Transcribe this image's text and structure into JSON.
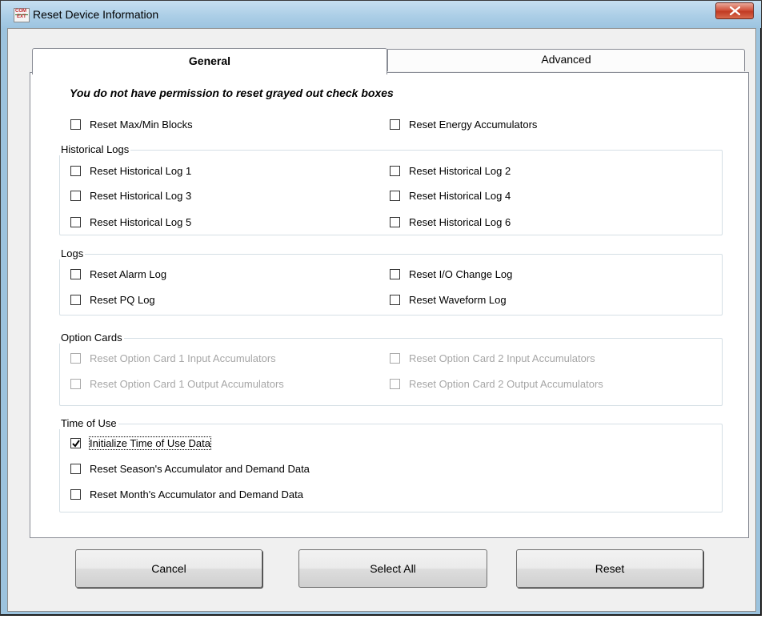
{
  "window": {
    "title": "Reset Device Information",
    "icon_top": "COM",
    "icon_bottom": "EXT"
  },
  "tabs": [
    {
      "label": "General",
      "selected": true
    },
    {
      "label": "Advanced",
      "selected": false
    }
  ],
  "notice": "You do not have permission to reset grayed out check boxes",
  "top_checks": [
    {
      "label": "Reset Max/Min Blocks",
      "checked": false,
      "enabled": true
    },
    {
      "label": "Reset Energy Accumulators",
      "checked": false,
      "enabled": true
    }
  ],
  "groups": {
    "historical_logs": {
      "title": "Historical Logs",
      "items": [
        {
          "label": "Reset Historical Log 1",
          "checked": false,
          "enabled": true
        },
        {
          "label": "Reset Historical Log 2",
          "checked": false,
          "enabled": true
        },
        {
          "label": "Reset Historical Log 3",
          "checked": false,
          "enabled": true
        },
        {
          "label": "Reset Historical Log 4",
          "checked": false,
          "enabled": true
        },
        {
          "label": "Reset Historical Log 5",
          "checked": false,
          "enabled": true
        },
        {
          "label": "Reset Historical Log 6",
          "checked": false,
          "enabled": true
        }
      ]
    },
    "logs": {
      "title": "Logs",
      "items": [
        {
          "label": "Reset Alarm Log",
          "checked": false,
          "enabled": true
        },
        {
          "label": "Reset I/O Change Log",
          "checked": false,
          "enabled": true
        },
        {
          "label": "Reset PQ Log",
          "checked": false,
          "enabled": true
        },
        {
          "label": "Reset Waveform Log",
          "checked": false,
          "enabled": true
        }
      ]
    },
    "option_cards": {
      "title": "Option Cards",
      "items": [
        {
          "label": "Reset Option Card 1 Input Accumulators",
          "checked": false,
          "enabled": false
        },
        {
          "label": "Reset Option Card 2 Input Accumulators",
          "checked": false,
          "enabled": false
        },
        {
          "label": "Reset Option Card 1 Output Accumulators",
          "checked": false,
          "enabled": false
        },
        {
          "label": "Reset Option Card 2 Output Accumulators",
          "checked": false,
          "enabled": false
        }
      ]
    },
    "time_of_use": {
      "title": "Time of Use",
      "items": [
        {
          "label": "Initialize Time of Use Data",
          "checked": true,
          "enabled": true,
          "focused": true
        },
        {
          "label": "Reset Season's Accumulator and Demand Data",
          "checked": false,
          "enabled": true
        },
        {
          "label": "Reset Month's Accumulator and Demand Data",
          "checked": false,
          "enabled": true
        }
      ]
    }
  },
  "buttons": {
    "cancel": "Cancel",
    "select_all": "Select All",
    "reset": "Reset"
  },
  "colors": {
    "title_bar": "#aacde6",
    "close_button": "#c13a22",
    "disabled_text": "#a6a6a6"
  }
}
